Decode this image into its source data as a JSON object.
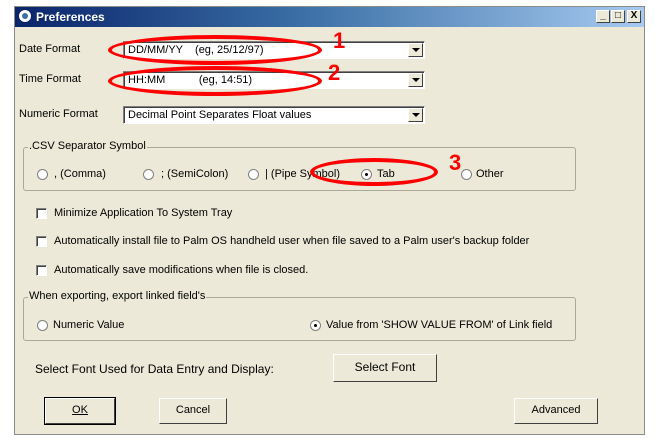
{
  "window": {
    "title": "Preferences",
    "controls": {
      "minimize": "_",
      "maximize": "□",
      "close": "X"
    }
  },
  "date_format": {
    "label": "Date Format",
    "value": "DD/MM/YY    (eg, 25/12/97)"
  },
  "time_format": {
    "label": "Time Format",
    "value": "HH:MM           (eg, 14:51)"
  },
  "numeric_format": {
    "label": "Numeric Format",
    "value": "Decimal Point Separates Float values"
  },
  "csv_separator": {
    "title": ".CSV Separator Symbol",
    "options": [
      {
        "label": ", (Comma)",
        "selected": false
      },
      {
        "label": "; (SemiColon)",
        "selected": false
      },
      {
        "label": "| (Pipe Symbol)",
        "selected": false
      },
      {
        "label": "Tab",
        "selected": true
      },
      {
        "label": "Other",
        "selected": false
      }
    ]
  },
  "checkboxes": [
    {
      "label": "Minimize Application To System Tray",
      "checked": false
    },
    {
      "label": "Automatically install file to Palm OS handheld user when file saved to a Palm user's backup folder",
      "checked": false
    },
    {
      "label": "Automatically save modifications when file is closed.",
      "checked": false
    }
  ],
  "export_linked": {
    "title": "When exporting, export linked field's",
    "options": [
      {
        "label": "Numeric Value",
        "selected": false
      },
      {
        "label": "Value from 'SHOW VALUE FROM' of Link field",
        "selected": true
      }
    ]
  },
  "font": {
    "label": "Select Font Used for Data Entry and Display:",
    "button": "Select Font"
  },
  "buttons": {
    "ok": "OK",
    "cancel": "Cancel",
    "advanced": "Advanced"
  },
  "annotations": {
    "marker_1": "1",
    "marker_2": "2",
    "marker_3": "3",
    "color": "#ff0000"
  }
}
